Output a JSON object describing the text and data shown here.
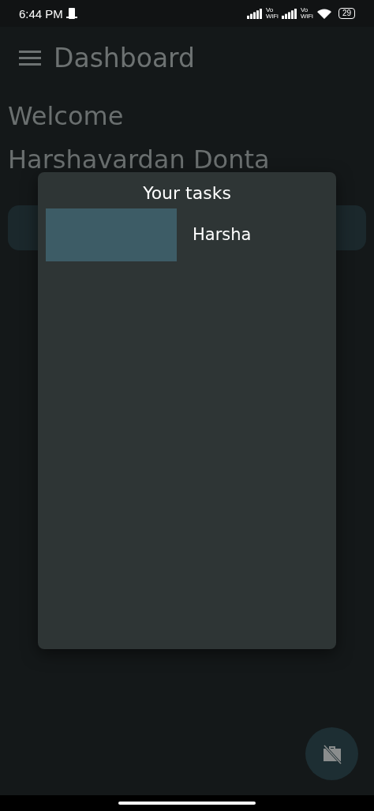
{
  "status_bar": {
    "time": "6:44 PM",
    "sim_labels": [
      {
        "top": "Vo",
        "bottom": "WiFi"
      },
      {
        "top": "Vo",
        "bottom": "WiFi"
      }
    ],
    "battery": "29"
  },
  "app_bar": {
    "title": "Dashboard"
  },
  "welcome": {
    "greeting": "Welcome",
    "name": "Harshavardan Donta"
  },
  "dialog": {
    "title": "Your tasks",
    "tasks": [
      {
        "label": "Harsha"
      }
    ]
  }
}
